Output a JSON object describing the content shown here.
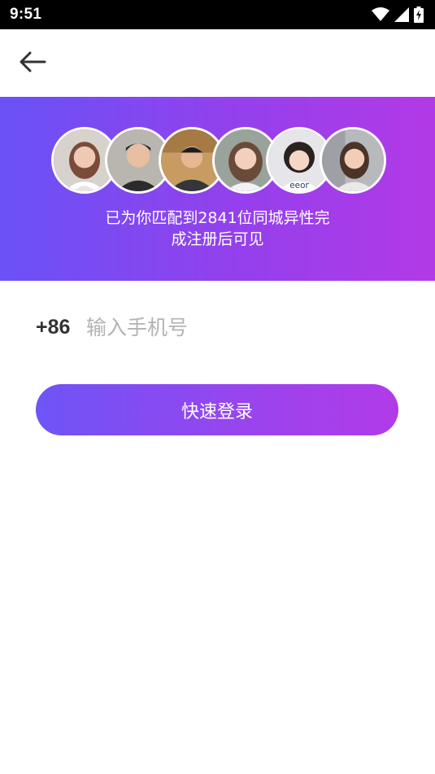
{
  "status_bar": {
    "time": "9:51",
    "icons": [
      "wifi-icon",
      "signal-icon",
      "battery-charging-icon"
    ]
  },
  "header": {
    "back_icon": "arrow-left-icon"
  },
  "banner": {
    "colors": {
      "gradient_start": "#6a52f7",
      "gradient_end": "#b23ae6"
    },
    "avatar_count": 6,
    "text_line1": "已为你匹配到2841位同城异性完",
    "text_line2": "成注册后可见"
  },
  "form": {
    "country_code": "+86",
    "phone_placeholder": "输入手机号",
    "phone_value": "",
    "submit_label": "快速登录"
  }
}
